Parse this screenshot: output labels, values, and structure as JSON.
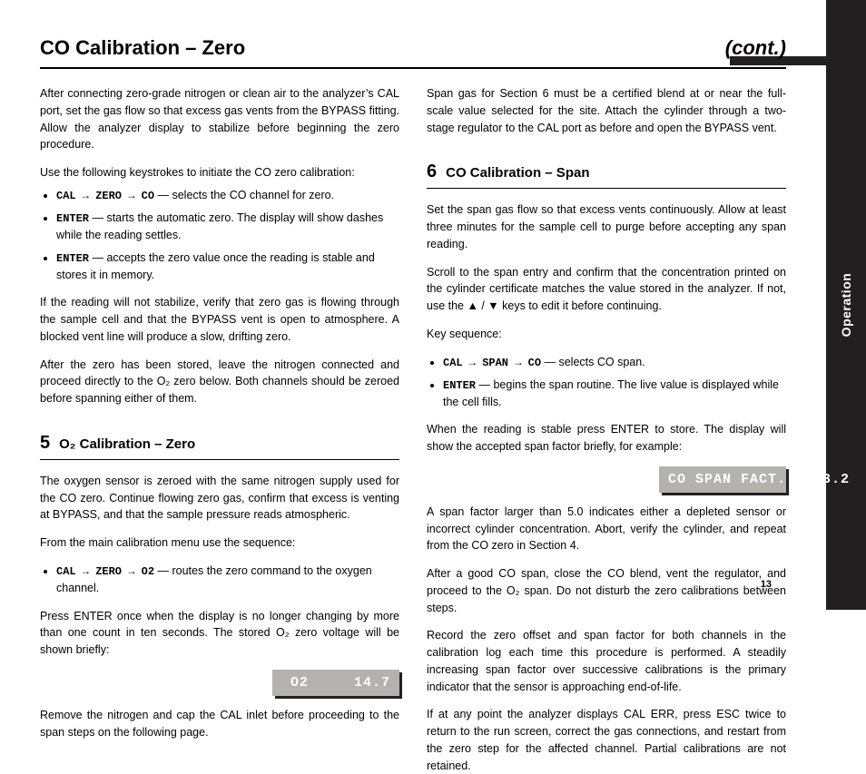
{
  "sideTab": "Operation",
  "pageTitleLeft": "CO Calibration – Zero",
  "pageTitleRight": "(cont.)",
  "pageNumber": "13",
  "leftCol": {
    "paras1": [
      "After connecting zero-grade nitrogen or clean air to the analyzer’s CAL port, set the gas flow so that excess gas vents from the BYPASS fitting. Allow the analyzer display to stabilize before beginning the zero procedure.",
      "Use the following keystrokes to initiate the CO zero calibration:"
    ],
    "steps1": [
      {
        "mono": "CAL → ZERO → CO",
        "tail": " — selects the CO channel for zero."
      },
      {
        "mono": "ENTER",
        "tail": " — starts the automatic zero. The display will show dashes while the reading settles."
      },
      {
        "mono": "ENTER",
        "tail": " — accepts the zero value once the reading is stable and stores it in memory."
      }
    ],
    "paras2": [
      "If the reading will not stabilize, verify that zero gas is flowing through the sample cell and that the BYPASS vent is open to atmosphere. A blocked vent line will produce a slow, drifting zero.",
      "After the zero has been stored, leave the nitrogen connected and proceed directly to the O₂ zero below. Both channels should be zeroed before spanning either of them."
    ],
    "sec5": {
      "num": "5",
      "title": "O₂ Calibration – Zero",
      "paras": [
        "The oxygen sensor is zeroed with the same nitrogen supply used for the CO zero. Continue flowing zero gas, confirm that excess is venting at BYPASS, and that the sample pressure reads atmospheric.",
        "From the main calibration menu use the sequence:"
      ],
      "steps": [
        {
          "mono": "CAL → ZERO → O2",
          "tail": " — routes the zero command to the oxygen channel."
        }
      ],
      "paras2": [
        "Press ENTER once when the display is no longer changing by more than one count in ten seconds. The stored O₂ zero voltage will be shown briefly:"
      ],
      "lcd": "O2     14.7",
      "paras3": [
        "Remove the nitrogen and cap the CAL inlet before proceeding to the span steps on the following page."
      ]
    }
  },
  "rightCol": {
    "lead": [
      "Span gas for Section 6 must be a certified blend at or near the full-scale value selected for the site. Attach the cylinder through a two-stage regulator to the CAL port as before and open the BYPASS vent."
    ],
    "sec6": {
      "num": "6",
      "title": "CO Calibration – Span",
      "paras": [
        "Set the span gas flow so that excess vents continuously. Allow at least three minutes for the sample cell to purge before accepting any span reading.",
        "Scroll to the span entry and confirm that the concentration printed on the cylinder certificate matches the value stored in the analyzer. If not, use the ▲ / ▼ keys to edit it before continuing.",
        "Key sequence:"
      ],
      "steps": [
        {
          "mono": "CAL → SPAN → CO",
          "tail": " — selects CO span."
        },
        {
          "mono": "ENTER",
          "tail": " — begins the span routine. The live value is displayed while the cell fills."
        }
      ],
      "paras2": [
        "When the reading is stable press ENTER to store. The display will show the accepted span factor briefly, for example:"
      ],
      "lcd": "CO SPAN FACT.    3.2",
      "paras3": [
        "A span factor larger than 5.0 indicates either a depleted sensor or incorrect cylinder concentration. Abort, verify the cylinder, and repeat from the CO zero in Section 4.",
        "After a good CO span, close the CO blend, vent the regulator, and proceed to the O₂ span. Do not disturb the zero calibrations between steps.",
        "Record the zero offset and span factor for both channels in the calibration log each time this procedure is performed. A steadily increasing span factor over successive calibrations is the primary indicator that the sensor is approaching end-of-life.",
        "If at any point the analyzer displays CAL ERR, press ESC twice to return to the run screen, correct the gas connections, and restart from the zero step for the affected channel. Partial calibrations are not retained."
      ]
    }
  }
}
